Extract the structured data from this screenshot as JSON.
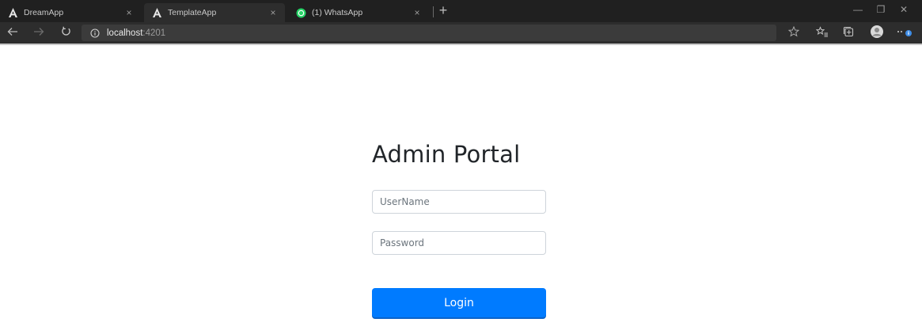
{
  "browser": {
    "tabs": [
      {
        "title": "DreamApp",
        "favicon": "angular-icon",
        "active": false
      },
      {
        "title": "TemplateApp",
        "favicon": "angular-icon",
        "active": true
      },
      {
        "title": "(1) WhatsApp",
        "favicon": "whatsapp-icon",
        "active": false
      }
    ],
    "tab_close_glyph": "×",
    "new_tab_glyph": "+",
    "window_controls": {
      "minimize": "—",
      "maximize": "❐",
      "close": "✕"
    },
    "address": {
      "host": "localhost",
      "port": ":4201"
    },
    "toolbar_icons": [
      "star-outline-icon",
      "favorites-icon",
      "collections-icon",
      "profile-avatar-icon",
      "more-icon"
    ]
  },
  "login": {
    "title": "Admin Portal",
    "username_placeholder": "UserName",
    "password_placeholder": "Password",
    "submit_label": "Login"
  },
  "colors": {
    "titlebar_bg": "#202020",
    "toolbar_bg": "#2d2d2d",
    "primary_button": "#007bff",
    "heading_text": "#212529"
  }
}
